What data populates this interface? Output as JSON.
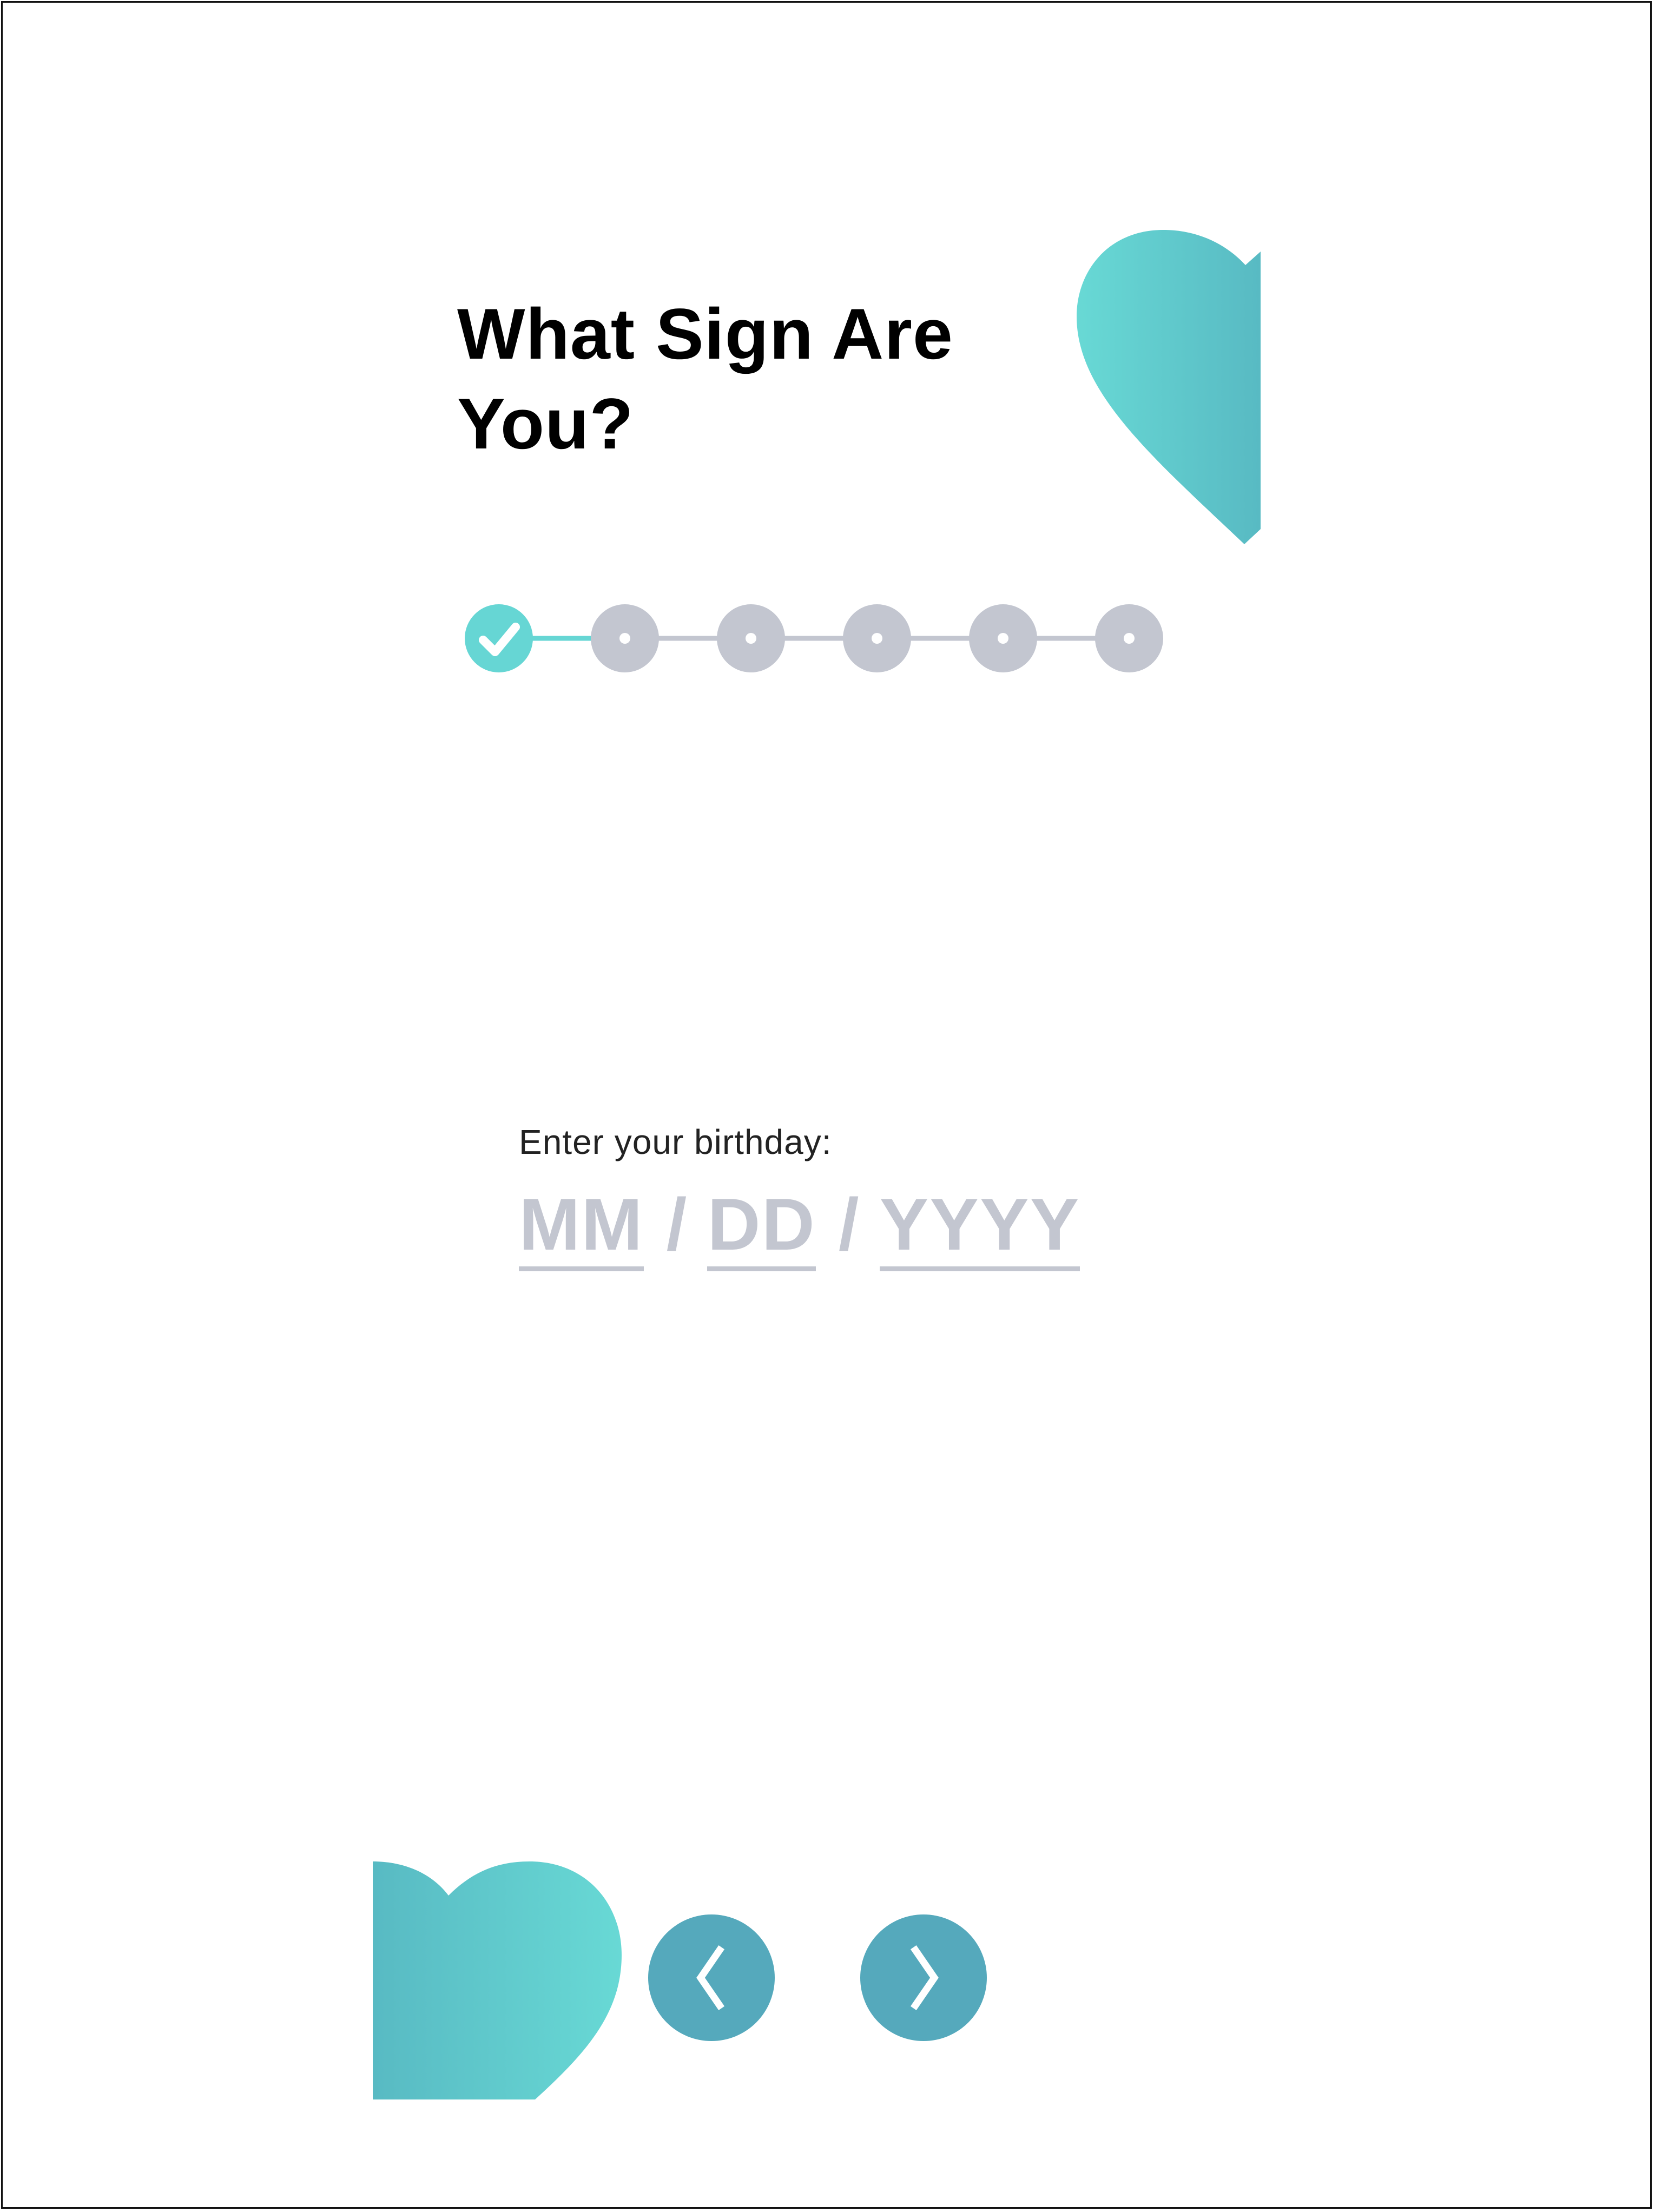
{
  "header": {
    "title_line1": "What Sign Are",
    "title_line2": "You?"
  },
  "progress": {
    "total_steps": 6,
    "completed_steps": 1,
    "active_color": "#66d6d4",
    "inactive_color": "#c3c6d0"
  },
  "birthday": {
    "label": "Enter your birthday:",
    "month_placeholder": "MM",
    "day_placeholder": "DD",
    "year_placeholder": "YYYY",
    "separator": "/"
  },
  "navigation": {
    "prev_icon": "chevron-left-icon",
    "next_icon": "chevron-right-icon",
    "button_color": "#55a9bc"
  },
  "decor": {
    "heart_gradient_light": "#68d9d5",
    "heart_gradient_dark": "#58bac3"
  }
}
